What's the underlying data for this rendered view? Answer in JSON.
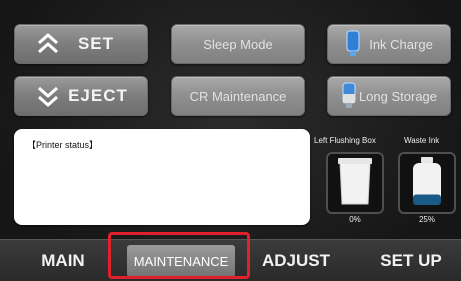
{
  "buttons": {
    "set": "SET",
    "eject": "EJECT",
    "sleep_mode": "Sleep Mode",
    "cr_maintenance": "CR Maintenance",
    "ink_charge": "Ink Charge",
    "long_storage": "Long Storage"
  },
  "icons": {
    "set": "chevron-up-icon",
    "eject": "chevron-down-icon",
    "ink_charge": "ink-pack-icon",
    "long_storage": "long-storage-icon",
    "flushing_box": "flushing-box-icon",
    "waste_ink": "waste-ink-bottle-icon"
  },
  "status": {
    "title": "【Printer status】",
    "message": ""
  },
  "gauges": {
    "flushing_box": {
      "label": "Left Flushing Box",
      "percent_text": "0%",
      "fill_fraction": 0.0
    },
    "waste_ink": {
      "label": "Waste Ink",
      "percent_text": "25%",
      "fill_fraction": 0.25
    }
  },
  "tabs": {
    "main": "MAIN",
    "maintenance": "MAINTENANCE",
    "adjust": "ADJUST",
    "setup": "SET UP",
    "active": "maintenance"
  },
  "colors": {
    "highlight": "#e0202a",
    "ink_blue": "#2f7fd6",
    "waste_ink_fill": "#1a5a86"
  }
}
